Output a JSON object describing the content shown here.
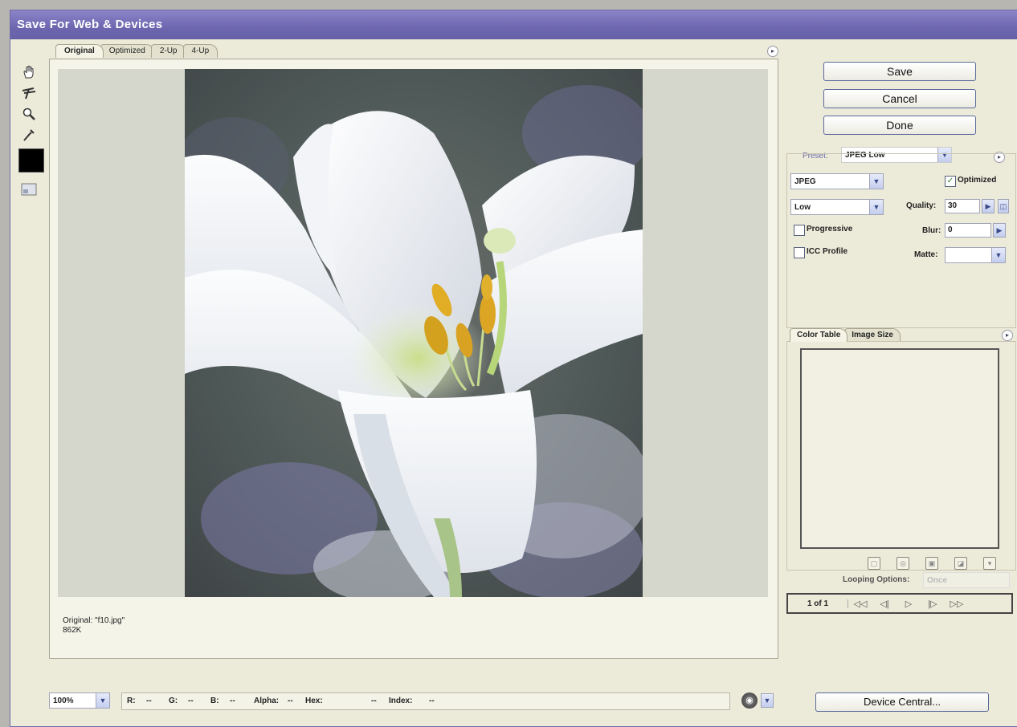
{
  "window": {
    "title": "Save For Web & Devices"
  },
  "tabs": [
    {
      "label": "Original"
    },
    {
      "label": "Optimized"
    },
    {
      "label": "2-Up"
    },
    {
      "label": "4-Up"
    }
  ],
  "tools": [
    "hand-tool-icon",
    "slice-select-tool-icon",
    "zoom-tool-icon",
    "eyedropper-tool-icon"
  ],
  "eyedropper_color": "#000000",
  "image_info": {
    "line1": "Original: \"f10.jpg\"",
    "line2": "862K"
  },
  "buttons": {
    "save": "Save",
    "cancel": "Cancel",
    "done": "Done",
    "device_central": "Device Central..."
  },
  "settings": {
    "preset_label": "Preset:",
    "preset_value": "JPEG Low",
    "format": "JPEG",
    "quality_preset": "Low",
    "optimized_label": "Optimized",
    "optimized_checked": true,
    "quality_label": "Quality:",
    "quality_value": "30",
    "progressive_label": "Progressive",
    "progressive_checked": false,
    "blur_label": "Blur:",
    "blur_value": "0",
    "icc_label": "ICC Profile",
    "icc_checked": false,
    "matte_label": "Matte:",
    "matte_value": ""
  },
  "color_table": {
    "tab_color_table": "Color Table",
    "tab_image_size": "Image Size"
  },
  "looping": {
    "label": "Looping Options:",
    "value": "Once"
  },
  "animation": {
    "frame": "1 of 1",
    "first": "◁◁",
    "prev": "◁|",
    "play": "▷",
    "next": "|▷",
    "last": "▷▷"
  },
  "status": {
    "zoom": "100%",
    "r": "R:",
    "r_val": "--",
    "g": "G:",
    "g_val": "--",
    "b": "B:",
    "b_val": "--",
    "alpha": "Alpha:",
    "alpha_val": "--",
    "hex": "Hex:",
    "hex_val": "--",
    "index": "Index:",
    "index_val": "--"
  }
}
